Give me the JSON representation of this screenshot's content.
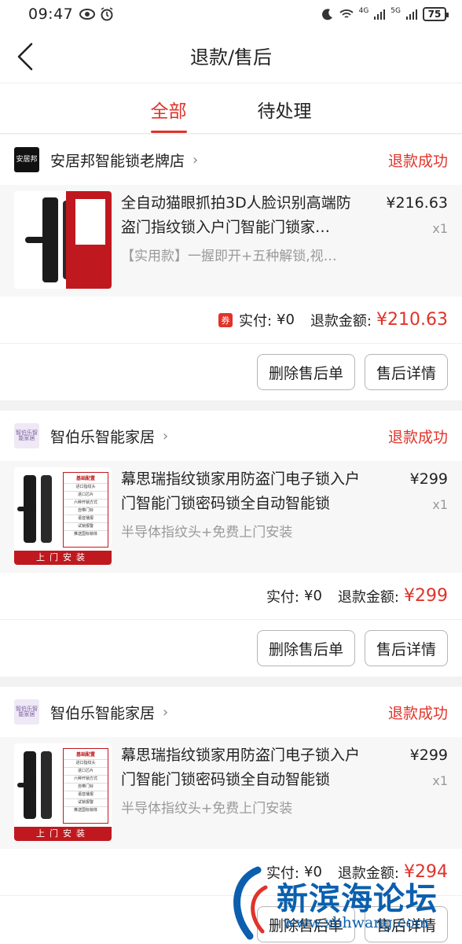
{
  "status_bar": {
    "time": "09:47",
    "battery": "75",
    "net_a": "4G",
    "net_b": "5G"
  },
  "header": {
    "title": "退款/售后"
  },
  "tabs": [
    {
      "label": "全部",
      "active": true
    },
    {
      "label": "待处理",
      "active": false
    }
  ],
  "orders": [
    {
      "shop_logo": "安居邦",
      "shop": "安居邦智能锁老牌店",
      "status": "退款成功",
      "title": "全自动猫眼抓拍3D人脸识别高端防盗门指纹锁入户门智能门锁家…",
      "spec": "【实用款】一握即开+五种解锁,视…",
      "price": "¥216.63",
      "qty": "x1",
      "coupon": "券",
      "paid_label": "实付:",
      "paid": "¥0",
      "refund_label": "退款金额:",
      "refund": "¥210.63",
      "btn_delete": "删除售后单",
      "btn_detail": "售后详情"
    },
    {
      "shop_logo": "智伯乐智能家居",
      "shop": "智伯乐智能家居",
      "status": "退款成功",
      "title": "幕思瑞指纹锁家用防盗门电子锁入户门智能门锁密码锁全自动智能锁",
      "spec": "半导体指纹头+免费上门安装",
      "price": "¥299",
      "qty": "x1",
      "paid_label": "实付:",
      "paid": "¥0",
      "refund_label": "退款金额:",
      "refund": "¥299",
      "btn_delete": "删除售后单",
      "btn_detail": "售后详情",
      "image_banner": "上门安装",
      "image_header": "基础配置",
      "image_features": [
        "进口指纹头",
        "进口芯片",
        "六种开锁方式",
        "自带门铃",
        "语音播报",
        "试锁报警",
        "推送国标锁体"
      ]
    },
    {
      "shop_logo": "智伯乐智能家居",
      "shop": "智伯乐智能家居",
      "status": "退款成功",
      "title": "幕思瑞指纹锁家用防盗门电子锁入户门智能门锁密码锁全自动智能锁",
      "spec": "半导体指纹头+免费上门安装",
      "price": "¥299",
      "qty": "x1",
      "paid_label": "实付:",
      "paid": "¥0",
      "refund_label": "退款金额:",
      "refund": "¥294",
      "btn_delete": "删除售后单",
      "btn_detail": "售后详情",
      "image_banner": "上门安装",
      "image_header": "基础配置",
      "image_features": [
        "进口指纹头",
        "进口芯片",
        "六种开锁方式",
        "自带门铃",
        "语音播报",
        "试锁报警",
        "推送国标锁体"
      ]
    }
  ],
  "watermark": {
    "text": "新滨海论坛",
    "url": "www.xbhwang.com"
  },
  "colors": {
    "accent": "#e0332a",
    "watermark": "#0b5fae"
  }
}
